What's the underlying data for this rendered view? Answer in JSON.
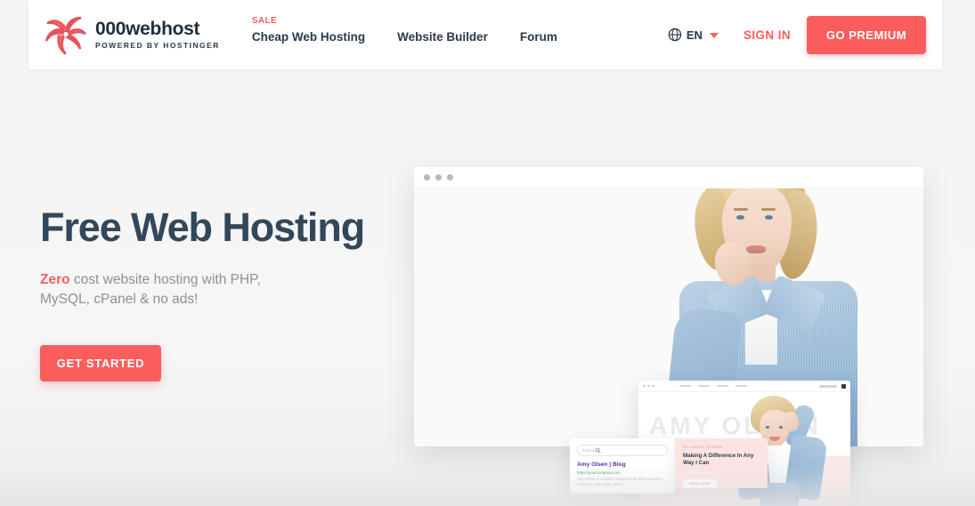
{
  "brand": {
    "name": "000webhost",
    "tagline": "POWERED BY HOSTINGER",
    "logo_icon": "swirl-flame-logo",
    "color": "#e8515a"
  },
  "header": {
    "nav": [
      {
        "label": "Cheap Web Hosting",
        "badge": "SALE"
      },
      {
        "label": "Website Builder",
        "badge": ""
      },
      {
        "label": "Forum",
        "badge": ""
      }
    ],
    "language": {
      "icon": "globe-icon",
      "label": "EN",
      "caret_icon": "chevron-down-icon"
    },
    "sign_in_label": "SIGN IN",
    "premium_label": "GO PREMIUM",
    "accent_color": "#fb5d5d"
  },
  "hero": {
    "title": "Free Web Hosting",
    "subtitle_accent": "Zero",
    "subtitle_rest": " cost website hosting with PHP, MySQL, cPanel & no ads!",
    "cta_label": "GET STARTED",
    "title_color": "#33475b",
    "subtitle_color": "#8a9199"
  },
  "mockup": {
    "browser_dots": [
      "dot",
      "dot",
      "dot"
    ],
    "site": {
      "hero_word": "AMY OLSEN"
    },
    "search_card": {
      "placeholder": "fashion",
      "result_title": "Amy Olsen | Blog",
      "result_url": "https://yourcompany.com",
      "result_desc": "Amy Olsen is a fashion blogger from San Francisco, California. She writes about...",
      "search_icon": "magnifier-icon",
      "title_color": "#4b35b5",
      "url_color": "#3f9a5b"
    },
    "pink_card": {
      "eyebrow": "MY LATEST STORIES",
      "title": "Making A Difference In Any Way I Can",
      "button_label": "READ MORE",
      "background": "#fbe4e3"
    }
  }
}
